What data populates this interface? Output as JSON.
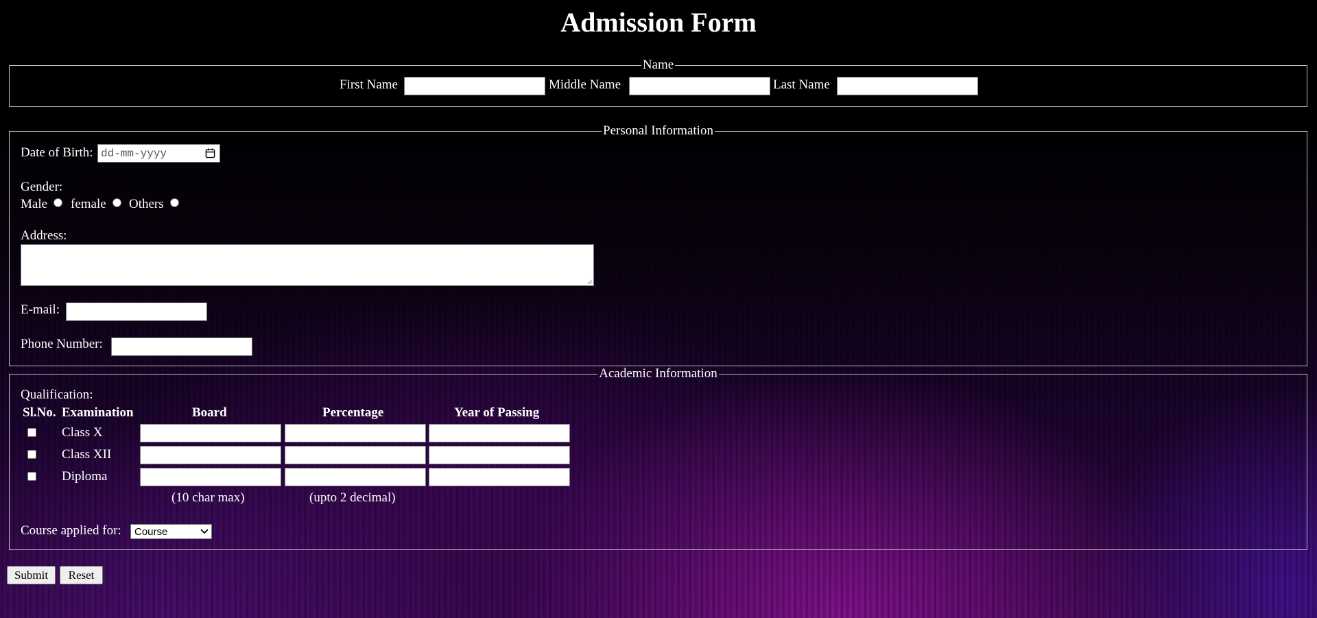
{
  "page": {
    "title": "Admission Form"
  },
  "name_section": {
    "legend": "Name",
    "first_label": "First Name",
    "middle_label": "Middle Name",
    "last_label": "Last Name",
    "first_value": "",
    "middle_value": "",
    "last_value": ""
  },
  "personal": {
    "legend": "Personal Information",
    "dob_label": "Date of Birth:",
    "dob_placeholder": "dd-mm-yyyy",
    "gender_label": "Gender:",
    "gender_options": [
      "Male",
      "female",
      "Others"
    ],
    "address_label": "Address:",
    "email_label": "E-mail:",
    "phone_label": "Phone Number:"
  },
  "academic": {
    "legend": "Academic Information",
    "qualification_label": "Qualification:",
    "headers": [
      "Sl.No.",
      "Examination",
      "Board",
      "Percentage",
      "Year of Passing"
    ],
    "rows": [
      {
        "exam": "Class X",
        "checked": false
      },
      {
        "exam": "Class XII",
        "checked": false
      },
      {
        "exam": "Diploma",
        "checked": false
      }
    ],
    "board_hint": "(10 char max)",
    "percentage_hint": "(upto 2 decimal)",
    "course_label": "Course applied for:",
    "course_selected": "Course"
  },
  "buttons": {
    "submit": "Submit",
    "reset": "Reset"
  }
}
